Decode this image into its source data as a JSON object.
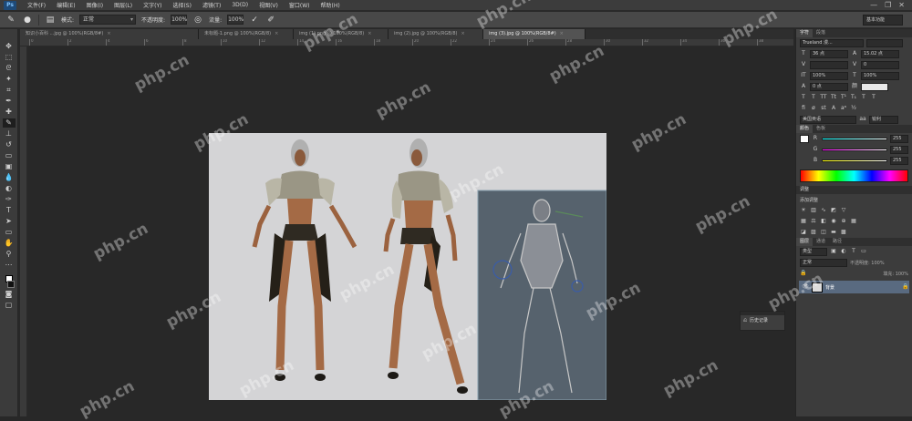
{
  "app": {
    "logo": "Ps"
  },
  "menu": [
    "文件(F)",
    "编辑(E)",
    "图像(I)",
    "图层(L)",
    "文字(Y)",
    "选择(S)",
    "滤镜(T)",
    "3D(D)",
    "视图(V)",
    "窗口(W)",
    "帮助(H)"
  ],
  "window_controls": {
    "minimize": "—",
    "restore": "❐",
    "close": "✕"
  },
  "options": {
    "mode_label": "模式:",
    "mode_value": "正常",
    "opacity_label": "不透明度:",
    "opacity_value": "100%",
    "flow_label": "流量:",
    "flow_value": "100%",
    "workspace": "基本功能"
  },
  "tabs": [
    {
      "label": "知识小百科 ...jpg @ 100%(RGB/8#)",
      "active": false
    },
    {
      "label": "未标题-1.png @ 100%(RGB/8)",
      "active": false
    },
    {
      "label": "img (1).png @ 100%(RGB/8)",
      "active": false
    },
    {
      "label": "img (2).jpg @ 100%(RGB/8)",
      "active": false
    },
    {
      "label": "img (3).jpg @ 100%(RGB/8#)",
      "active": true
    }
  ],
  "ruler": [
    "0",
    "2",
    "4",
    "6",
    "8",
    "10",
    "12",
    "14",
    "16",
    "18",
    "20",
    "22",
    "24",
    "26",
    "28",
    "30",
    "32",
    "34",
    "36",
    "38"
  ],
  "right_panel": {
    "tabs": [
      "字符",
      "段落"
    ],
    "font_family": "Trueland 漫...",
    "font_size": "36 点",
    "leading": "15.02 点",
    "tracking": "0",
    "scale_h": "100%",
    "scale_v": "100%",
    "baseline": "0 点",
    "language": "美国英语",
    "aa_mode": "锐利",
    "color_tabs": [
      "颜色",
      "色板"
    ],
    "r": "255",
    "g": "255",
    "b": "255",
    "adjust_header": "调整",
    "add_adjust": "添加调整",
    "layers_tabs": [
      "图层",
      "通道",
      "路径"
    ],
    "kind": "类型",
    "blend": "正常",
    "opacity": "不透明度: 100%",
    "fill": "填充: 100%",
    "layer_name": "背景"
  },
  "history": {
    "item": "历史记录"
  },
  "watermark": "php.cn",
  "colors": {
    "accent_layer": "#596a80",
    "canvas_bg": "#282828",
    "panel_bg": "#3c3c3c"
  }
}
